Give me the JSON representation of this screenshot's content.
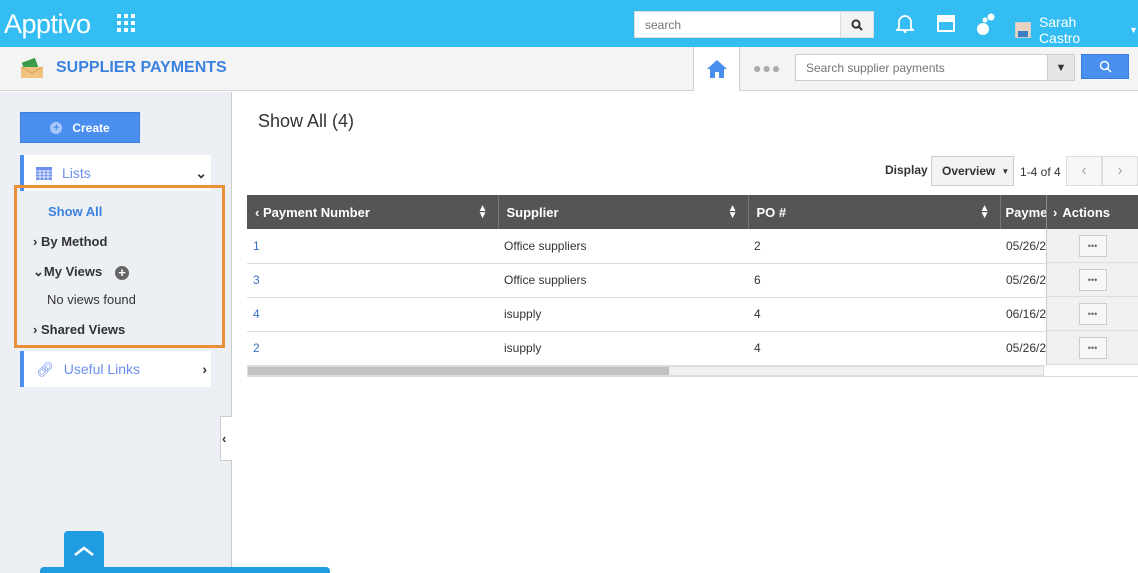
{
  "topbar": {
    "logo": "Apptivo",
    "search_placeholder": "search",
    "user_name": "Sarah Castro",
    "icons": [
      "apps-grid-icon",
      "search-icon",
      "bell-icon",
      "store-icon",
      "chat-icon",
      "user-avatar",
      "caret-down-icon"
    ]
  },
  "app": {
    "title": "SUPPLIER PAYMENTS",
    "search_placeholder": "Search supplier payments"
  },
  "sidebar": {
    "create_label": "Create",
    "lists_label": "Lists",
    "items": [
      {
        "label": "Show All",
        "active": true
      },
      {
        "label": "By Method"
      },
      {
        "label": "My Views"
      },
      {
        "label": "No views found"
      },
      {
        "label": "Shared Views"
      }
    ],
    "useful_links_label": "Useful Links"
  },
  "main": {
    "heading": "Show All (4)",
    "display_label": "Display",
    "display_value": "Overview",
    "range": "1-4 of 4",
    "columns": [
      "Payment Number",
      "Supplier",
      "PO #",
      "Payme",
      "Actions"
    ],
    "rows": [
      {
        "number": "1",
        "supplier": "Office suppliers",
        "po": "2",
        "date": "05/26/2"
      },
      {
        "number": "3",
        "supplier": "Office suppliers",
        "po": "6",
        "date": "05/26/2"
      },
      {
        "number": "4",
        "supplier": "isupply",
        "po": "4",
        "date": "06/16/2"
      },
      {
        "number": "2",
        "supplier": "isupply",
        "po": "4",
        "date": "05/26/2"
      }
    ],
    "row_action_label": "•••"
  },
  "colors": {
    "topbar": "#33bdf2",
    "accent": "#4a8ef0",
    "highlight": "#e8913a",
    "table_header": "#555555"
  }
}
